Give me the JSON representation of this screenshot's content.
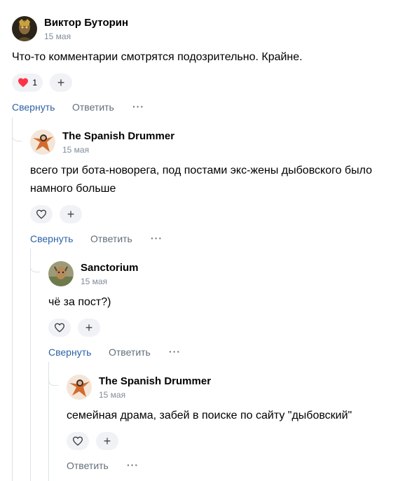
{
  "comments": [
    {
      "author": "Виктор Буторин",
      "date": "15 мая",
      "text": "Что-то комментарии смотрятся подозрительно. Крайне.",
      "likes": "1",
      "collapse_label": "Свернуть",
      "reply_label": "Ответить",
      "more_label": "···"
    },
    {
      "author": "The Spanish Drummer",
      "date": "15 мая",
      "text": "всего три бота-новорега, под постами экс-жены дыбовского было намного больше",
      "collapse_label": "Свернуть",
      "reply_label": "Ответить",
      "more_label": "···"
    },
    {
      "author": "Sanctorium",
      "date": "15 мая",
      "text": "чё за пост?)",
      "collapse_label": "Свернуть",
      "reply_label": "Ответить",
      "more_label": "···"
    },
    {
      "author": "The Spanish Drummer",
      "date": "15 мая",
      "text": "семейная драма, забей в поиске по сайту \"дыбовский\"",
      "reply_label": "Ответить",
      "more_label": "···"
    }
  ],
  "icons": {
    "plus": "+"
  },
  "colors": {
    "link_blue": "#2d62a6",
    "secondary": "#818c99",
    "like_red": "#ff3347",
    "pill_bg": "#f0f2f5"
  }
}
